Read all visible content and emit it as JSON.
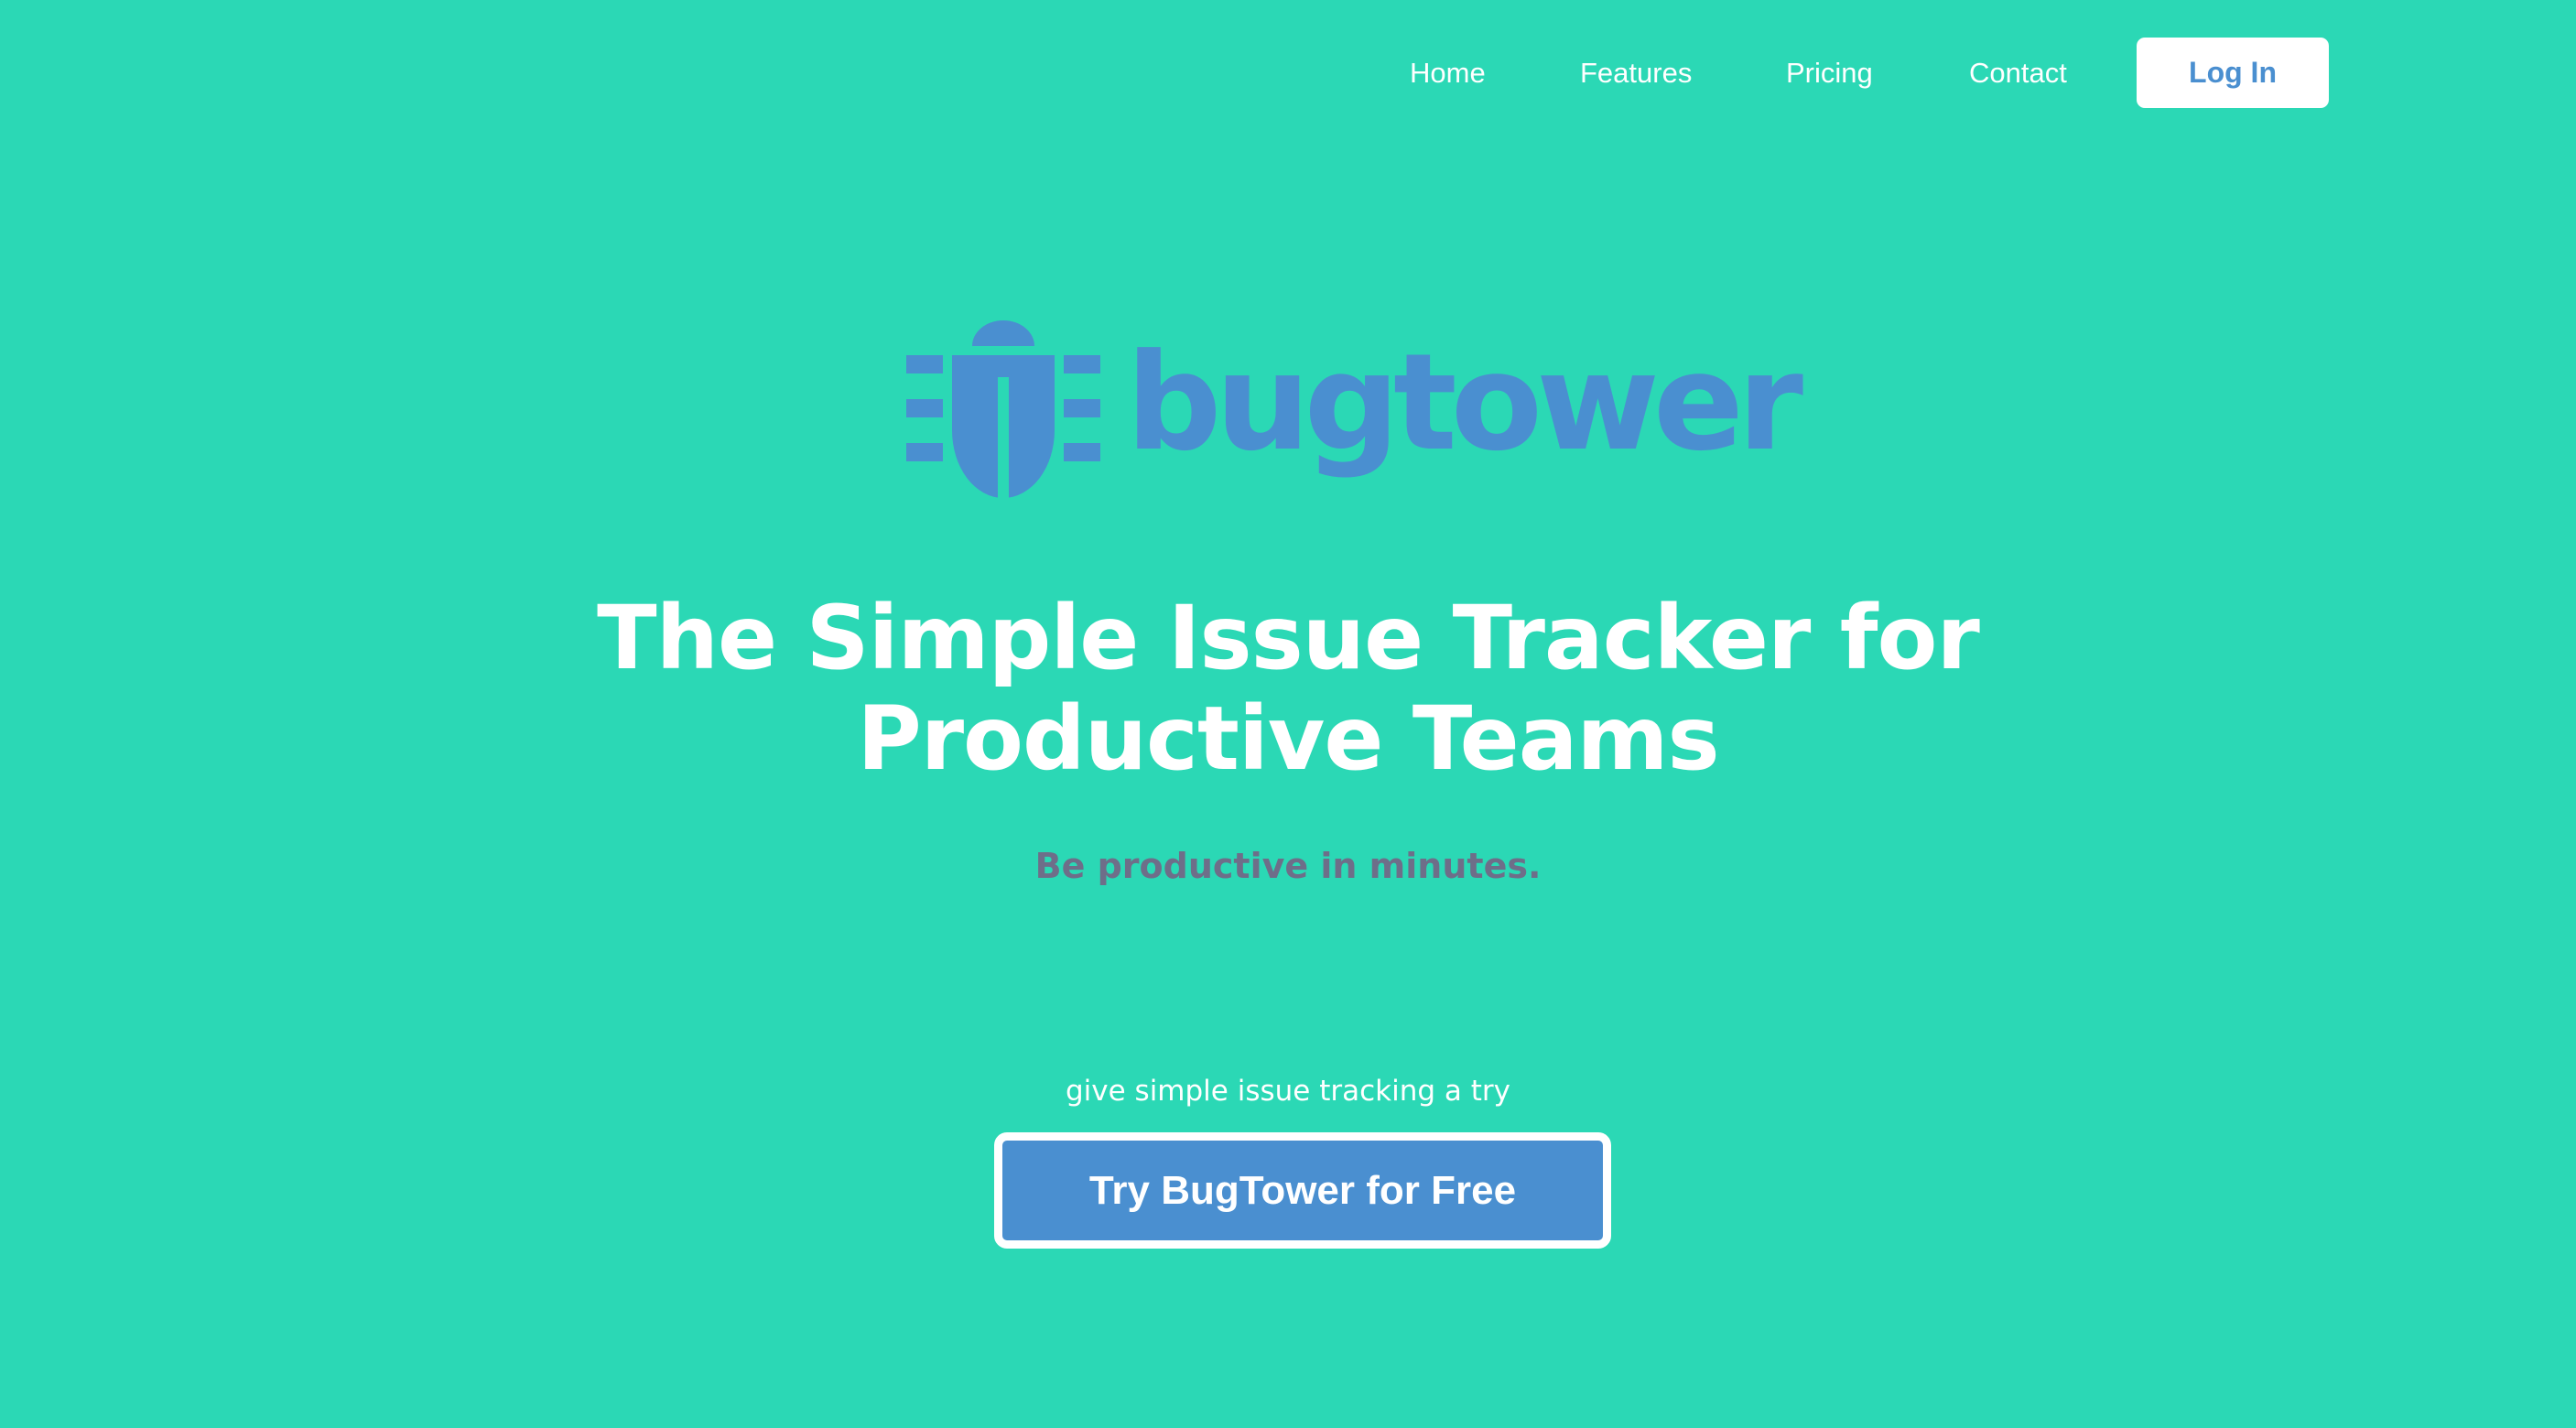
{
  "nav": {
    "items": [
      {
        "label": "Home"
      },
      {
        "label": "Features"
      },
      {
        "label": "Pricing"
      },
      {
        "label": "Contact"
      }
    ],
    "login_label": "Log In"
  },
  "logo": {
    "wordmark": "bugtower",
    "icon": "bug-tower-icon",
    "color": "#4a8fd0"
  },
  "hero": {
    "title": "The Simple Issue Tracker for Productive Teams",
    "subtitle": "Be productive in minutes."
  },
  "cta": {
    "caption": "give simple issue tracking a try",
    "button_label": "Try BugTower for Free"
  },
  "colors": {
    "background": "#2bd8b5",
    "accent": "#4a8fd0",
    "subtitle": "#6e6e89",
    "white": "#ffffff"
  }
}
